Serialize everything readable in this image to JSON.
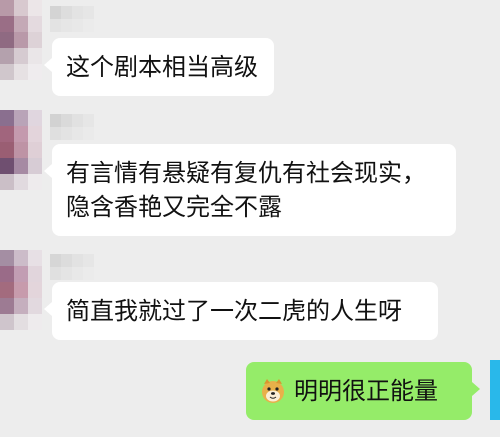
{
  "messages": [
    {
      "id": "m1",
      "direction": "incoming",
      "sender_name_hidden": true,
      "text": "这个剧本相当高级"
    },
    {
      "id": "m2",
      "direction": "incoming",
      "sender_name_hidden": true,
      "line1": "有言情有悬疑有复仇有社会现实，",
      "line2": "隐含香艳又完全不露"
    },
    {
      "id": "m3",
      "direction": "incoming",
      "sender_name_hidden": true,
      "text": "简直我就过了一次二虎的人生呀"
    },
    {
      "id": "m4",
      "direction": "outgoing",
      "emoji": "doge-emoji-icon",
      "text": "明明很正能量"
    }
  ],
  "colors": {
    "background": "#ededed",
    "incoming_bubble": "#ffffff",
    "outgoing_bubble": "#95ec69",
    "self_avatar": "#29b8ea"
  }
}
